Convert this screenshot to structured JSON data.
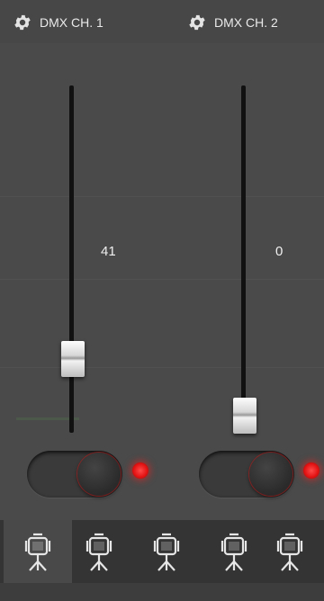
{
  "header": {
    "channel_1_label": "DMX CH. 1",
    "channel_2_label": "DMX CH. 2",
    "icon": "gear-icon"
  },
  "faders": [
    {
      "value_label": "41",
      "level": 0.16,
      "toggle_on": true,
      "indicator_color": "#ff2a2a"
    },
    {
      "value_label": "0",
      "level": 0.0,
      "toggle_on": true,
      "indicator_color": "#ff2a2a"
    }
  ],
  "fixture_tabs": [
    {
      "icon": "spotlight-icon",
      "active": true
    },
    {
      "icon": "spotlight-icon",
      "active": false
    },
    {
      "icon": "spotlight-icon",
      "active": false
    },
    {
      "icon": "spotlight-icon",
      "active": false
    },
    {
      "icon": "spotlight-icon",
      "active": false
    }
  ],
  "colors": {
    "background": "#4a4a4a",
    "fixture_bar": "#343434",
    "active_tab": "#494949",
    "led": "#ff2a2a"
  }
}
